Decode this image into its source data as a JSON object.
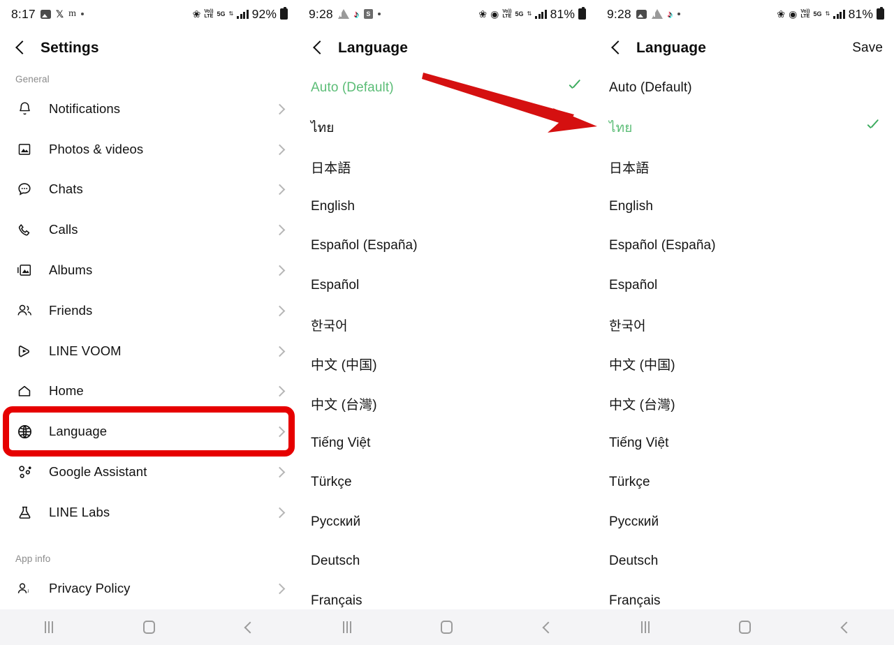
{
  "accent": {
    "green": "#5cbd77",
    "check_green": "#3cab5e",
    "annotation_red": "#e60000",
    "chevron_gray": "#b6b6b6",
    "section_gray": "#8b8b8b"
  },
  "panel1": {
    "status": {
      "time": "8:17",
      "battery": "92%",
      "network_label": "5G",
      "volte_label_top": "Vo))",
      "volte_label_bottom": "LTE",
      "left_icons": [
        "photo-icon",
        "x-app-icon",
        "m-app-icon",
        "dot-icon"
      ],
      "right_icons": [
        "bluetooth-icon",
        "volte-icon",
        "5g-icon",
        "data-transfer-icon",
        "signal-bars-icon",
        "battery-icon"
      ]
    },
    "appbar": {
      "title": "Settings",
      "back": "back-chevron-icon"
    },
    "sections": [
      {
        "label": "General",
        "items": [
          {
            "icon": "bell-icon",
            "label": "Notifications",
            "glyph": "🔔"
          },
          {
            "icon": "photo-icon",
            "label": "Photos & videos",
            "glyph": "🖼"
          },
          {
            "icon": "chat-bubble-icon",
            "label": "Chats",
            "glyph": "💬"
          },
          {
            "icon": "phone-icon",
            "label": "Calls",
            "glyph": "📞"
          },
          {
            "icon": "albums-icon",
            "label": "Albums",
            "glyph": "🗂"
          },
          {
            "icon": "friends-icon",
            "label": "Friends",
            "glyph": "👥"
          },
          {
            "icon": "line-voom-icon",
            "label": "LINE VOOM",
            "glyph": "▷"
          },
          {
            "icon": "home-icon",
            "label": "Home",
            "glyph": "⌂"
          },
          {
            "icon": "globe-icon",
            "label": "Language",
            "glyph": "🌐"
          },
          {
            "icon": "google-assistant-icon",
            "label": "Google Assistant",
            "glyph": "⚙"
          },
          {
            "icon": "flask-icon",
            "label": "LINE Labs",
            "glyph": "⚗"
          }
        ]
      },
      {
        "label": "App info",
        "items": [
          {
            "icon": "privacy-person-icon",
            "label": "Privacy Policy",
            "glyph": "👤"
          }
        ]
      }
    ],
    "highlighted_item": "Language"
  },
  "panel2": {
    "status": {
      "time": "9:28",
      "battery": "81%",
      "network_label": "5G",
      "left_icons": [
        "drive-icon",
        "tiktok-icon",
        "shopee-icon",
        "dot-icon"
      ],
      "right_icons": [
        "bluetooth-icon",
        "cast-icon",
        "volte-icon",
        "5g-icon",
        "data-transfer-icon",
        "signal-bars-icon",
        "battery-icon"
      ]
    },
    "appbar": {
      "title": "Language",
      "back": "back-chevron-icon",
      "action": ""
    },
    "selected_language": "Auto (Default)",
    "languages": [
      {
        "name": "Auto (Default)",
        "selected": true
      },
      {
        "name": "ไทย",
        "selected": false
      },
      {
        "name": "日本語",
        "selected": false
      },
      {
        "name": "English",
        "selected": false
      },
      {
        "name": "Español (España)",
        "selected": false
      },
      {
        "name": "Español",
        "selected": false
      },
      {
        "name": "한국어",
        "selected": false
      },
      {
        "name": "中文 (中国)",
        "selected": false
      },
      {
        "name": "中文 (台灣)",
        "selected": false
      },
      {
        "name": "Tiếng Việt",
        "selected": false
      },
      {
        "name": "Türkçe",
        "selected": false
      },
      {
        "name": "Русский",
        "selected": false
      },
      {
        "name": "Deutsch",
        "selected": false
      },
      {
        "name": "Français",
        "selected": false
      }
    ]
  },
  "panel3": {
    "status": {
      "time": "9:28",
      "battery": "81%",
      "network_label": "5G",
      "left_icons": [
        "photo-icon",
        "drive-icon",
        "tiktok-icon",
        "dot-icon"
      ],
      "right_icons": [
        "bluetooth-icon",
        "cast-icon",
        "volte-icon",
        "5g-icon",
        "data-transfer-icon",
        "signal-bars-icon",
        "battery-icon"
      ]
    },
    "appbar": {
      "title": "Language",
      "back": "back-chevron-icon",
      "action": "Save"
    },
    "selected_language": "ไทย",
    "languages": [
      {
        "name": "Auto (Default)",
        "selected": false
      },
      {
        "name": "ไทย",
        "selected": true
      },
      {
        "name": "日本語",
        "selected": false
      },
      {
        "name": "English",
        "selected": false
      },
      {
        "name": "Español (España)",
        "selected": false
      },
      {
        "name": "Español",
        "selected": false
      },
      {
        "name": "한국어",
        "selected": false
      },
      {
        "name": "中文 (中国)",
        "selected": false
      },
      {
        "name": "中文 (台灣)",
        "selected": false
      },
      {
        "name": "Tiếng Việt",
        "selected": false
      },
      {
        "name": "Türkçe",
        "selected": false
      },
      {
        "name": "Русский",
        "selected": false
      },
      {
        "name": "Deutsch",
        "selected": false
      },
      {
        "name": "Français",
        "selected": false
      }
    ]
  },
  "navbar": {
    "items": [
      "recents-icon",
      "home-icon",
      "back-icon"
    ]
  },
  "annotation": {
    "arrow_color": "#d51010",
    "description": "arrow-pointing-to-thai-option"
  }
}
